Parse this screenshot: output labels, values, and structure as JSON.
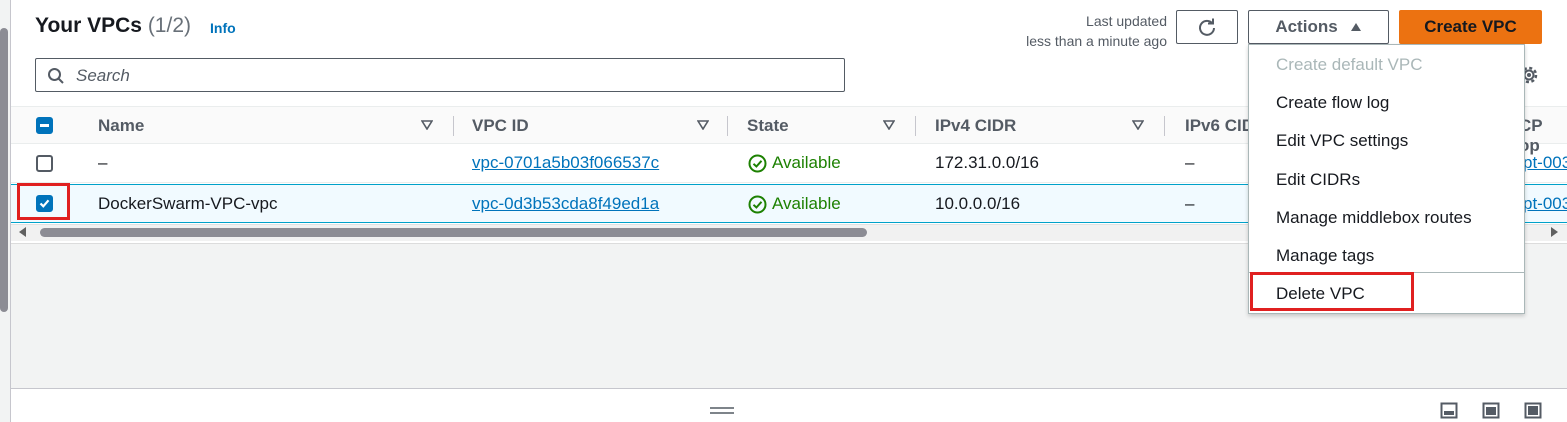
{
  "header": {
    "title": "Your VPCs",
    "count": "(1/2)",
    "info_label": "Info",
    "last_updated_label": "Last updated",
    "last_updated_value": "less than a minute ago",
    "actions_label": "Actions",
    "create_label": "Create VPC"
  },
  "search": {
    "placeholder": "Search"
  },
  "table": {
    "columns": [
      "Name",
      "VPC ID",
      "State",
      "IPv4 CIDR",
      "IPv6 CID"
    ],
    "partial_column": "CP op",
    "rows": [
      {
        "selected": false,
        "name": "–",
        "vpc_id": "vpc-0701a5b03f066537c",
        "state": "Available",
        "ipv4_cidr": "172.31.0.0/16",
        "ipv6_cidr": "–",
        "dhcp": "pt-003"
      },
      {
        "selected": true,
        "name": "DockerSwarm-VPC-vpc",
        "vpc_id": "vpc-0d3b53cda8f49ed1a",
        "state": "Available",
        "ipv4_cidr": "10.0.0.0/16",
        "ipv6_cidr": "–",
        "dhcp": "pt-003"
      }
    ]
  },
  "actions_menu": {
    "items": [
      {
        "label": "Create default VPC",
        "disabled": true
      },
      {
        "label": "Create flow log",
        "disabled": false
      },
      {
        "label": "Edit VPC settings",
        "disabled": false
      },
      {
        "label": "Edit CIDRs",
        "disabled": false
      },
      {
        "label": "Manage middlebox routes",
        "disabled": false
      },
      {
        "label": "Manage tags",
        "disabled": false
      },
      {
        "label": "Delete VPC",
        "disabled": false
      }
    ]
  },
  "colors": {
    "primary": "#ec7211",
    "link": "#0073bb",
    "success": "#1d8102",
    "highlight": "#e02020"
  },
  "icons": {
    "refresh": "refresh-icon",
    "actions_caret": "caret-up-icon",
    "search": "search-icon",
    "settings": "gear-icon",
    "sort": "sort-down-icon",
    "status": "check-circle-icon"
  }
}
